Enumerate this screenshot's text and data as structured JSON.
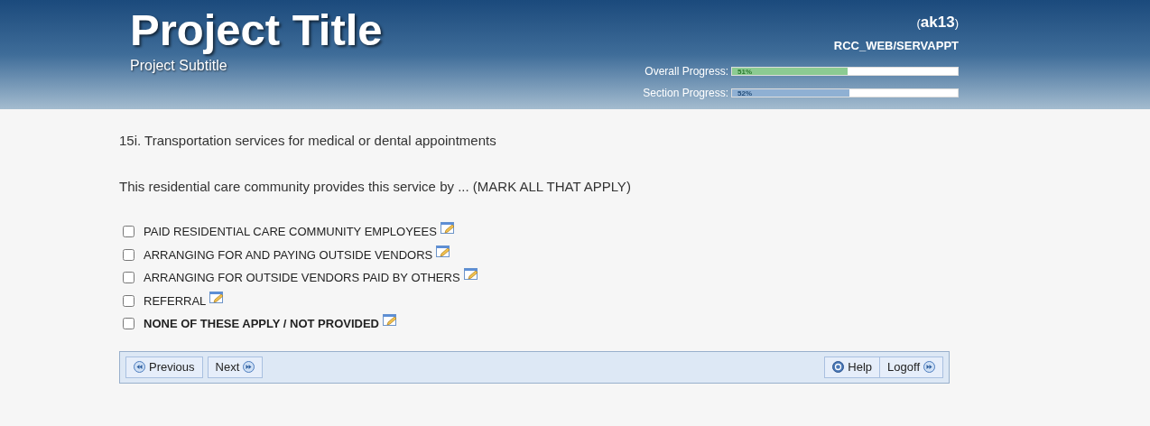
{
  "header": {
    "title": "Project Title",
    "subtitle": "Project Subtitle",
    "user_open": "(",
    "user": "ak13",
    "user_close": ")",
    "path": "RCC_WEB/SERVAPPT",
    "progress": [
      {
        "label": "Overall Progress:",
        "level": 0.51,
        "reading": "51%",
        "kind": "overall"
      },
      {
        "label": "Section Progress:",
        "level": 0.52,
        "reading": "52%",
        "kind": "section"
      }
    ]
  },
  "question": {
    "number_text": "15i. Transportation services for medical or dental appointments",
    "prompt": "This residential care community provides this service by ... (MARK ALL THAT APPLY)",
    "options": [
      {
        "label": "PAID RESIDENTIAL CARE COMMUNITY EMPLOYEES",
        "checked": false,
        "kind": "option"
      },
      {
        "label": "ARRANGING FOR AND PAYING OUTSIDE VENDORS",
        "checked": false,
        "kind": "option"
      },
      {
        "label": "ARRANGING FOR OUTSIDE VENDORS PAID BY OTHERS",
        "checked": false,
        "kind": "option"
      },
      {
        "label": "REFERRAL",
        "checked": false,
        "kind": "option"
      },
      {
        "label": "NONE OF THESE APPLY / NOT PROVIDED",
        "checked": false,
        "kind": "exclusive"
      }
    ]
  },
  "nav": {
    "left": [
      {
        "label": "Previous",
        "kind": "previous"
      },
      {
        "label": "Next",
        "kind": "next"
      }
    ],
    "right": [
      {
        "label": "Help",
        "kind": "help"
      },
      {
        "label": "Logoff",
        "kind": "next"
      }
    ]
  }
}
